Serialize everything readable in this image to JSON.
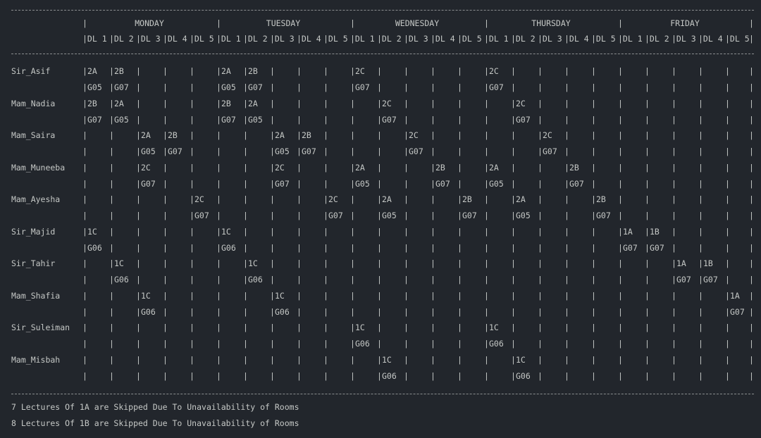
{
  "terminal": {
    "days": [
      "MONDAY",
      "TUESDAY",
      "WEDNESDAY",
      "THURSDAY",
      "FRIDAY"
    ],
    "slots": [
      "DL 1",
      "DL 2",
      "DL 3",
      "DL 4",
      "DL 5"
    ],
    "teachers": [
      {
        "name": "Sir_Asif",
        "classes": [
          "2A",
          "2B",
          "",
          "",
          "",
          "2A",
          "2B",
          "",
          "",
          "",
          "2C",
          "",
          "",
          "",
          "",
          "2C",
          "",
          "",
          "",
          "",
          "",
          "",
          "",
          "",
          ""
        ],
        "rooms": [
          "G05",
          "G07",
          "",
          "",
          "",
          "G05",
          "G07",
          "",
          "",
          "",
          "G07",
          "",
          "",
          "",
          "",
          "G07",
          "",
          "",
          "",
          "",
          "",
          "",
          "",
          "",
          ""
        ]
      },
      {
        "name": "Mam_Nadia",
        "classes": [
          "2B",
          "2A",
          "",
          "",
          "",
          "2B",
          "2A",
          "",
          "",
          "",
          "",
          "2C",
          "",
          "",
          "",
          "",
          "2C",
          "",
          "",
          "",
          "",
          "",
          "",
          "",
          ""
        ],
        "rooms": [
          "G07",
          "G05",
          "",
          "",
          "",
          "G07",
          "G05",
          "",
          "",
          "",
          "",
          "G07",
          "",
          "",
          "",
          "",
          "G07",
          "",
          "",
          "",
          "",
          "",
          "",
          "",
          ""
        ]
      },
      {
        "name": "Mam_Saira",
        "classes": [
          "",
          "",
          "2A",
          "2B",
          "",
          "",
          "",
          "2A",
          "2B",
          "",
          "",
          "",
          "2C",
          "",
          "",
          "",
          "",
          "2C",
          "",
          "",
          "",
          "",
          "",
          "",
          ""
        ],
        "rooms": [
          "",
          "",
          "G05",
          "G07",
          "",
          "",
          "",
          "G05",
          "G07",
          "",
          "",
          "",
          "G07",
          "",
          "",
          "",
          "",
          "G07",
          "",
          "",
          "",
          "",
          "",
          "",
          ""
        ]
      },
      {
        "name": "Mam_Muneeba",
        "classes": [
          "",
          "",
          "2C",
          "",
          "",
          "",
          "",
          "2C",
          "",
          "",
          "2A",
          "",
          "",
          "2B",
          "",
          "2A",
          "",
          "",
          "2B",
          "",
          "",
          "",
          "",
          "",
          ""
        ],
        "rooms": [
          "",
          "",
          "G07",
          "",
          "",
          "",
          "",
          "G07",
          "",
          "",
          "G05",
          "",
          "",
          "G07",
          "",
          "G05",
          "",
          "",
          "G07",
          "",
          "",
          "",
          "",
          "",
          ""
        ]
      },
      {
        "name": "Mam_Ayesha",
        "classes": [
          "",
          "",
          "",
          "",
          "2C",
          "",
          "",
          "",
          "",
          "2C",
          "",
          "2A",
          "",
          "",
          "2B",
          "",
          "2A",
          "",
          "",
          "2B",
          "",
          "",
          "",
          "",
          ""
        ],
        "rooms": [
          "",
          "",
          "",
          "",
          "G07",
          "",
          "",
          "",
          "",
          "G07",
          "",
          "G05",
          "",
          "",
          "G07",
          "",
          "G05",
          "",
          "",
          "G07",
          "",
          "",
          "",
          "",
          ""
        ]
      },
      {
        "name": "Sir_Majid",
        "classes": [
          "1C",
          "",
          "",
          "",
          "",
          "1C",
          "",
          "",
          "",
          "",
          "",
          "",
          "",
          "",
          "",
          "",
          "",
          "",
          "",
          "",
          "1A",
          "1B",
          "",
          "",
          ""
        ],
        "rooms": [
          "G06",
          "",
          "",
          "",
          "",
          "G06",
          "",
          "",
          "",
          "",
          "",
          "",
          "",
          "",
          "",
          "",
          "",
          "",
          "",
          "",
          "G07",
          "G07",
          "",
          "",
          ""
        ]
      },
      {
        "name": "Sir_Tahir",
        "classes": [
          "",
          "1C",
          "",
          "",
          "",
          "",
          "1C",
          "",
          "",
          "",
          "",
          "",
          "",
          "",
          "",
          "",
          "",
          "",
          "",
          "",
          "",
          "",
          "1A",
          "1B",
          ""
        ],
        "rooms": [
          "",
          "G06",
          "",
          "",
          "",
          "",
          "G06",
          "",
          "",
          "",
          "",
          "",
          "",
          "",
          "",
          "",
          "",
          "",
          "",
          "",
          "",
          "",
          "G07",
          "G07",
          ""
        ]
      },
      {
        "name": "Mam_Shafia",
        "classes": [
          "",
          "",
          "1C",
          "",
          "",
          "",
          "",
          "1C",
          "",
          "",
          "",
          "",
          "",
          "",
          "",
          "",
          "",
          "",
          "",
          "",
          "",
          "",
          "",
          "",
          "1A"
        ],
        "rooms": [
          "",
          "",
          "G06",
          "",
          "",
          "",
          "",
          "G06",
          "",
          "",
          "",
          "",
          "",
          "",
          "",
          "",
          "",
          "",
          "",
          "",
          "",
          "",
          "",
          "",
          "G07"
        ]
      },
      {
        "name": "Sir_Suleiman",
        "classes": [
          "",
          "",
          "",
          "",
          "",
          "",
          "",
          "",
          "",
          "",
          "1C",
          "",
          "",
          "",
          "",
          "1C",
          "",
          "",
          "",
          "",
          "",
          "",
          "",
          "",
          ""
        ],
        "rooms": [
          "",
          "",
          "",
          "",
          "",
          "",
          "",
          "",
          "",
          "",
          "G06",
          "",
          "",
          "",
          "",
          "G06",
          "",
          "",
          "",
          "",
          "",
          "",
          "",
          "",
          ""
        ]
      },
      {
        "name": "Mam_Misbah",
        "classes": [
          "",
          "",
          "",
          "",
          "",
          "",
          "",
          "",
          "",
          "",
          "",
          "1C",
          "",
          "",
          "",
          "",
          "1C",
          "",
          "",
          "",
          "",
          "",
          "",
          "",
          ""
        ],
        "rooms": [
          "",
          "",
          "",
          "",
          "",
          "",
          "",
          "",
          "",
          "",
          "",
          "G06",
          "",
          "",
          "",
          "",
          "G06",
          "",
          "",
          "",
          "",
          "",
          "",
          "",
          ""
        ]
      }
    ],
    "footer_lines": [
      "7 Lectures Of 1A are Skipped Due To Unavailability of Rooms",
      "8 Lectures Of 1B are Skipped Due To Unavailability of Rooms"
    ]
  }
}
